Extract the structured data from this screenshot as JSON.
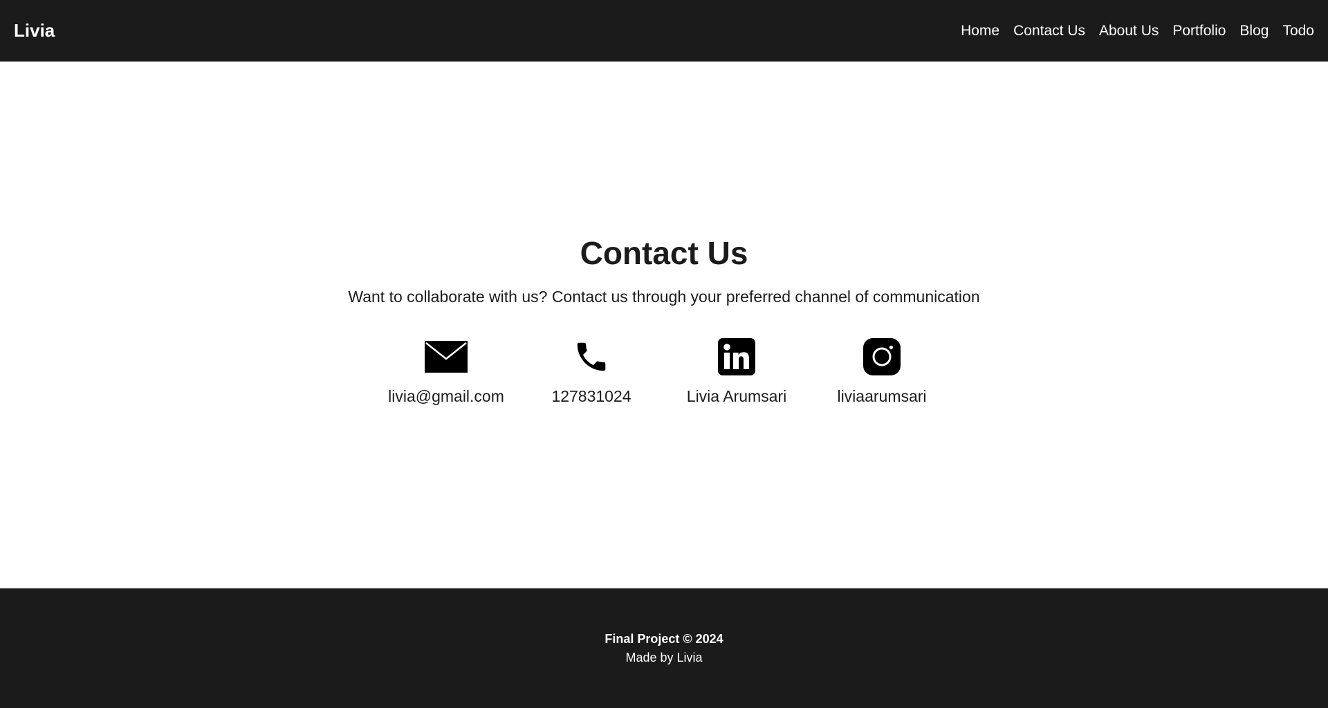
{
  "header": {
    "brand": "Livia",
    "nav": [
      {
        "label": "Home"
      },
      {
        "label": "Contact Us"
      },
      {
        "label": "About Us"
      },
      {
        "label": "Portfolio"
      },
      {
        "label": "Blog"
      },
      {
        "label": "Todo"
      }
    ]
  },
  "main": {
    "title": "Contact Us",
    "subtitle": "Want to collaborate with us? Contact us through your preferred channel of communication",
    "contacts": [
      {
        "icon": "envelope-icon",
        "label": "livia@gmail.com"
      },
      {
        "icon": "phone-icon",
        "label": "127831024"
      },
      {
        "icon": "linkedin-icon",
        "label": "Livia Arumsari"
      },
      {
        "icon": "instagram-icon",
        "label": "liviaarumsari"
      }
    ]
  },
  "footer": {
    "title": "Final Project © 2024",
    "made_by": "Made by Livia"
  },
  "colors": {
    "dark": "#1b1b1b",
    "light": "#ffffff"
  }
}
